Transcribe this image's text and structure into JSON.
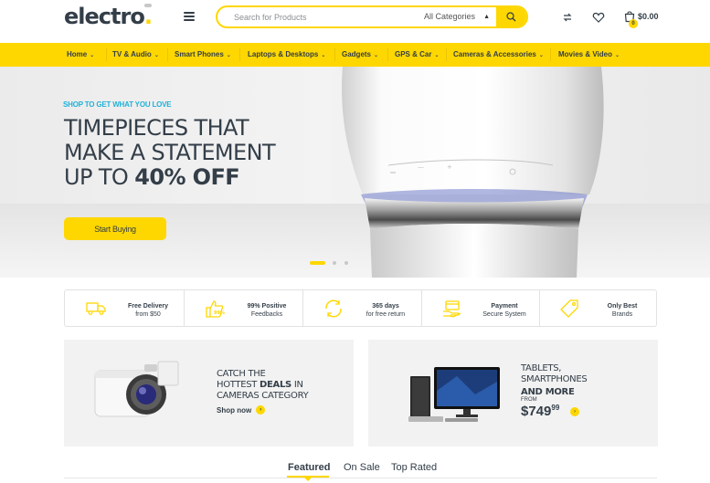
{
  "header": {
    "logo_text": "electro",
    "logo_dot": ".",
    "search_placeholder": "Search for Products",
    "category_select": "All Categories",
    "cart_total": "$0.00",
    "cart_count": "0"
  },
  "nav": {
    "items": [
      {
        "label": "Home"
      },
      {
        "label": "TV & Audio"
      },
      {
        "label": "Smart Phones"
      },
      {
        "label": "Laptops & Desktops"
      },
      {
        "label": "Gadgets"
      },
      {
        "label": "GPS & Car"
      },
      {
        "label": "Cameras & Accessories"
      },
      {
        "label": "Movies & Video"
      }
    ]
  },
  "hero": {
    "subtitle": "SHOP TO GET WHAT YOU LOVE",
    "title_line1": "TIMEPIECES THAT",
    "title_line2": "MAKE A STATEMENT",
    "title_line3_prefix": "UP TO ",
    "title_line3_bold": "40% OFF",
    "button_label": "Start Buying",
    "slides_total": 3,
    "active_slide": 1
  },
  "features": [
    {
      "bold": "Free Delivery",
      "text": "from $50",
      "icon": "truck-icon"
    },
    {
      "bold": "99% Positive",
      "text": "Feedbacks",
      "icon": "thumbs-up-icon"
    },
    {
      "bold": "365 days",
      "text": "for free return",
      "icon": "return-icon"
    },
    {
      "bold": "Payment",
      "text": "Secure System",
      "icon": "payment-icon"
    },
    {
      "bold": "Only Best",
      "text": "Brands",
      "icon": "tag-icon"
    }
  ],
  "banner_cameras": {
    "line1": "CATCH THE",
    "line2_prefix": "HOTTEST ",
    "line2_bold": "DEALS",
    "line2_suffix": " IN",
    "line3": "CAMERAS CATEGORY",
    "link": "Shop now"
  },
  "banner_tablets": {
    "line1": "TABLETS,",
    "line2": "SMARTPHONES",
    "bold": "AND MORE",
    "from": "FROM",
    "price_main": "$749",
    "price_cents": "99"
  },
  "tabs": [
    {
      "label": "Featured",
      "active": true
    },
    {
      "label": "On Sale",
      "active": false
    },
    {
      "label": "Top Rated",
      "active": false
    }
  ],
  "colors": {
    "accent": "#fed700",
    "text": "#333e48",
    "subtitle": "#1fb2d8"
  }
}
